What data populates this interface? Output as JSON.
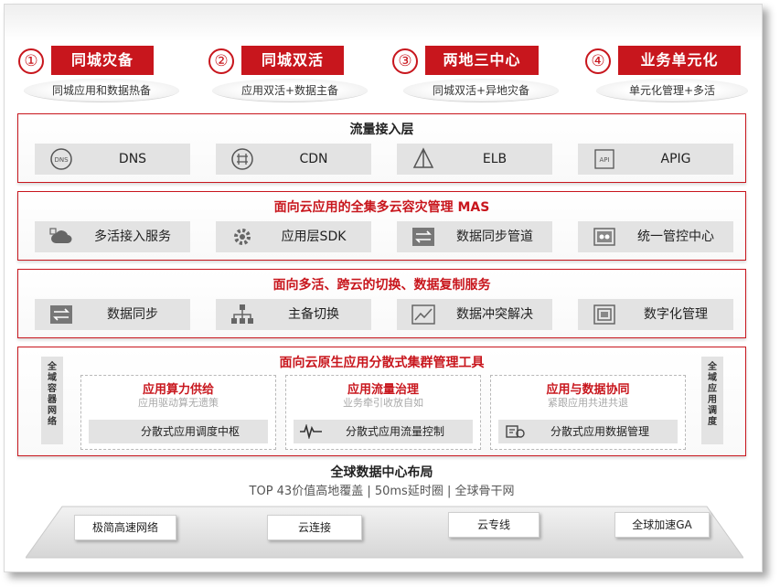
{
  "pillars": [
    {
      "num": "①",
      "title": "同城灾备",
      "sub": "同城应用和数据热备"
    },
    {
      "num": "②",
      "title": "同城双活",
      "sub": "应用双活+数据主备"
    },
    {
      "num": "③",
      "title": "两地三中心",
      "sub": "同城双活+异地灾备"
    },
    {
      "num": "④",
      "title": "业务单元化",
      "sub": "单元化管理+多活"
    }
  ],
  "traffic_layer": {
    "title": "流量接入层",
    "items": [
      {
        "label": "DNS",
        "icon": "dns-icon"
      },
      {
        "label": "CDN",
        "icon": "cdn-icon"
      },
      {
        "label": "ELB",
        "icon": "elb-icon"
      },
      {
        "label": "APIG",
        "icon": "api-icon"
      }
    ]
  },
  "mas_layer": {
    "title": "面向云应用的全集多云容灾管理 MAS",
    "items": [
      {
        "label": "多活接入服务",
        "icon": "cloud-access-icon"
      },
      {
        "label": "应用层SDK",
        "icon": "gear-icon"
      },
      {
        "label": "数据同步管道",
        "icon": "sync-pipe-icon"
      },
      {
        "label": "统一管控中心",
        "icon": "control-center-icon"
      }
    ]
  },
  "switch_layer": {
    "title": "面向多活、跨云的切换、数据复制服务",
    "items": [
      {
        "label": "数据同步",
        "icon": "sync-icon"
      },
      {
        "label": "主备切换",
        "icon": "hierarchy-icon"
      },
      {
        "label": "数据冲突解决",
        "icon": "chart-line-icon"
      },
      {
        "label": "数字化管理",
        "icon": "digital-manage-icon"
      }
    ]
  },
  "cluster_layer": {
    "title": "面向云原生应用分散式集群管理工具",
    "left_label": [
      "全",
      "域",
      "容",
      "器",
      "网",
      "络"
    ],
    "right_label": [
      "全",
      "域",
      "应",
      "用",
      "调",
      "度"
    ],
    "boxes": [
      {
        "title": "应用算力供给",
        "sub": "应用驱动算无遗策",
        "bar": "分散式应用调度中枢",
        "icon": ""
      },
      {
        "title": "应用流量治理",
        "sub": "业务牵引收放自如",
        "bar": "分散式应用流量控制",
        "icon": "waveform-icon"
      },
      {
        "title": "应用与数据协同",
        "sub": "紧跟应用共进共退",
        "bar": "分散式应用数据管理",
        "icon": "data-manage-icon"
      }
    ]
  },
  "global": {
    "title": "全球数据中心布局",
    "sub": "TOP 43价值高地覆盖 | 50ms延时圈 | 全球骨干网",
    "platform": [
      "极简高速网络",
      "云连接",
      "云专线",
      "全球加速GA"
    ]
  },
  "colors": {
    "accent": "#c8161d",
    "cell_bg": "#e3e3e3"
  }
}
